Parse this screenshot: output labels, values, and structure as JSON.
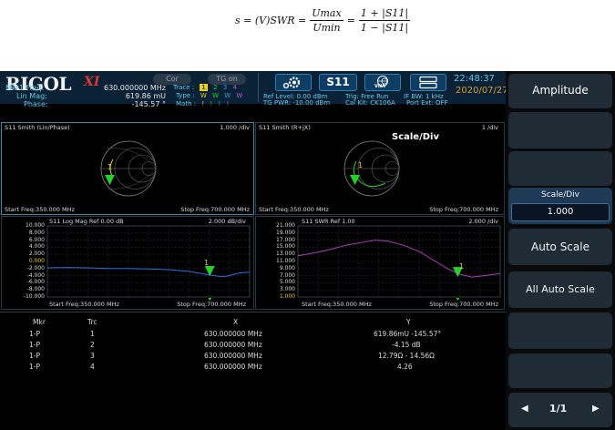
{
  "formula": {
    "s_eq": "s = (V)SWR =",
    "frac1_num": "Umax",
    "frac1_den": "Umin",
    "eq2": "=",
    "frac2_num": "1 + |S11|",
    "frac2_den": "1 − |S11|"
  },
  "header": {
    "brand": "RIGOL",
    "brand_mark": "XI",
    "cor_label": "Cor",
    "tg_label": "TG on",
    "marker": [
      {
        "label": "Mkr1 Freq:",
        "value": "630.000000 MHz"
      },
      {
        "label": "Lin Mag:",
        "value": "619.86 mU"
      },
      {
        "label": "Phase:",
        "value": "-145.57 °"
      }
    ],
    "trace_row": {
      "label": "Trace :",
      "items": [
        "1",
        "2",
        "3",
        "4"
      ]
    },
    "type_row": {
      "label": "Type :",
      "items": [
        "W",
        "W",
        "W",
        "W"
      ]
    },
    "math_row": {
      "label": "Math :",
      "items": [
        "!",
        "!",
        "!",
        "!"
      ]
    },
    "s11": "S11",
    "vna": "VNA",
    "ref_level": "Ref Level: 0.00 dBm",
    "tg_pwr": "TG PWR: -10.00 dBm",
    "trig": "Trig: Free Run",
    "if_bw": "IF BW: 1 kHz",
    "cal_kit": "Cal Kit: CK106A",
    "port_ext": "Port Ext: OFF",
    "time": "22:48:37",
    "date": "2020/07/27"
  },
  "softkeys": {
    "amplitude": "Amplitude",
    "scale_div": "Scale/Div",
    "scale_div_value": "1.000",
    "auto_scale": "Auto Scale",
    "all_auto_scale": "All Auto Scale",
    "page": "1/1"
  },
  "panes": {
    "p1": {
      "title": "S11 Smith (Lin/Phase)",
      "div": "1.000 /div",
      "start": "Start Freq:350.000 MHz",
      "stop": "Stop Freq:700.000 MHz",
      "marker": "1"
    },
    "p2": {
      "title": "S11 Smith (R+jX)",
      "div": "1 /div",
      "overlay": "Scale/Div",
      "start": "Start Freq:350.000 MHz",
      "stop": "Stop Freq:700.000 MHz",
      "marker": "1"
    },
    "p3": {
      "title": "S11  Log Mag   Ref 0.00 dB",
      "div": "2.000  dB/div",
      "start": "Start Freq:350.000 MHz",
      "stop": "Stop Freq:700.000 MHz",
      "marker": "1",
      "yticks": [
        "10.000",
        "8.000",
        "6.000",
        "4.000",
        "2.000",
        "0.000",
        "-2.000",
        "-4.000",
        "-6.000",
        "-8.000",
        "-10.000"
      ]
    },
    "p4": {
      "title": "S11  SWR   Ref 1.00",
      "div": "2.000  /div",
      "start": "Start Freq:350.000 MHz",
      "stop": "Stop Freq:700.000 MHz",
      "marker": "1",
      "yticks": [
        "21.000",
        "19.000",
        "17.000",
        "15.000",
        "13.000",
        "11.000",
        "9.000",
        "7.000",
        "5.000",
        "3.000",
        "1.000"
      ]
    }
  },
  "table": {
    "headers": [
      "Mkr",
      "Trc",
      "X",
      "Y"
    ],
    "rows": [
      [
        "1-P",
        "1",
        "630.000000 MHz",
        "619.86mU  -145.57°"
      ],
      [
        "1-P",
        "2",
        "630.000000 MHz",
        "-4.15 dB"
      ],
      [
        "1-P",
        "3",
        "630.000000 MHz",
        "12.79Ω  - 14.56Ω"
      ],
      [
        "1-P",
        "4",
        "630.000000 MHz",
        "4.26"
      ]
    ]
  },
  "colors": {
    "accent": "#63c7e8",
    "marker": "#22d42a",
    "trace_blue": "#2f6fe0",
    "trace_magenta": "#b03dbf",
    "date": "#d89a2c"
  }
}
